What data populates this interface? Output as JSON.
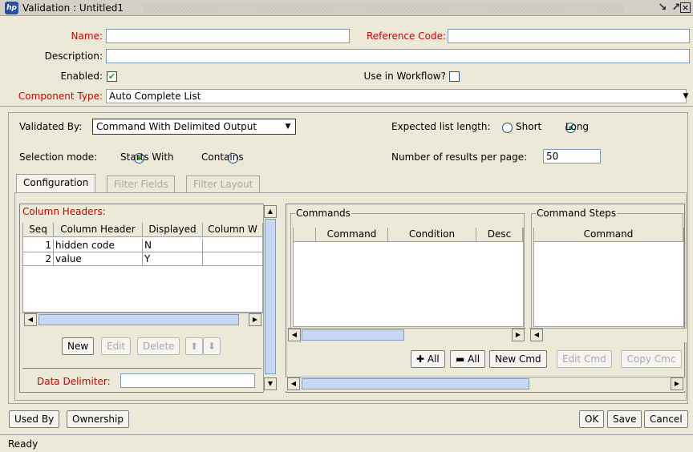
{
  "window": {
    "title": "Validation : Untitled1",
    "logo_text": "hp",
    "controls": [
      "restore-icon",
      "maximize-icon",
      "close-icon"
    ]
  },
  "form": {
    "name_label": "Name:",
    "name_value": "",
    "reference_code_label": "Reference Code:",
    "reference_code_value": "",
    "description_label": "Description:",
    "description_value": "",
    "enabled_label": "Enabled:",
    "enabled_checked": true,
    "use_in_workflow_label": "Use in Workflow?",
    "use_in_workflow_checked": false,
    "component_type_label": "Component Type:",
    "component_type_value": "Auto Complete List"
  },
  "validation": {
    "validated_by_label": "Validated By:",
    "validated_by_value": "Command With Delimited Output",
    "expected_list_length_label": "Expected list length:",
    "expected_list_length_options": [
      "Short",
      "Long"
    ],
    "expected_list_length_selected": "Long",
    "selection_mode_label": "Selection mode:",
    "selection_mode_options": [
      "Starts With",
      "Contains"
    ],
    "selection_mode_selected": "Starts With",
    "results_per_page_label": "Number of results per page:",
    "results_per_page_value": "50"
  },
  "tabs": [
    {
      "label": "Configuration",
      "active": true,
      "enabled": true
    },
    {
      "label": "Filter Fields",
      "active": false,
      "enabled": false
    },
    {
      "label": "Filter Layout",
      "active": false,
      "enabled": false
    }
  ],
  "column_headers": {
    "title": "Column Headers:",
    "columns": [
      "Seq",
      "Column Header",
      "Displayed",
      "Column W"
    ],
    "rows": [
      {
        "seq": "1",
        "header": "hidden code",
        "displayed": "N",
        "width": ""
      },
      {
        "seq": "2",
        "header": "value",
        "displayed": "Y",
        "width": ""
      }
    ],
    "buttons": {
      "new": "New",
      "edit": "Edit",
      "delete": "Delete"
    },
    "data_delimiter_label": "Data Delimiter:",
    "data_delimiter_value": ""
  },
  "commands": {
    "title": "Commands",
    "columns": [
      "Command",
      "Condition",
      "Desc"
    ]
  },
  "command_steps": {
    "title": "Command Steps",
    "columns": [
      "Command"
    ]
  },
  "command_buttons": {
    "add_all": "All",
    "remove_all": "All",
    "new_cmd": "New Cmd",
    "edit_cmd": "Edit Cmd",
    "copy_cmd": "Copy Cmc"
  },
  "footer": {
    "used_by": "Used By",
    "ownership": "Ownership",
    "ok": "OK",
    "save": "Save",
    "cancel": "Cancel",
    "status": "Ready"
  },
  "colors": {
    "required_label": "#cc0000",
    "background": "#ece9d8",
    "check_mark": "#21a121"
  }
}
